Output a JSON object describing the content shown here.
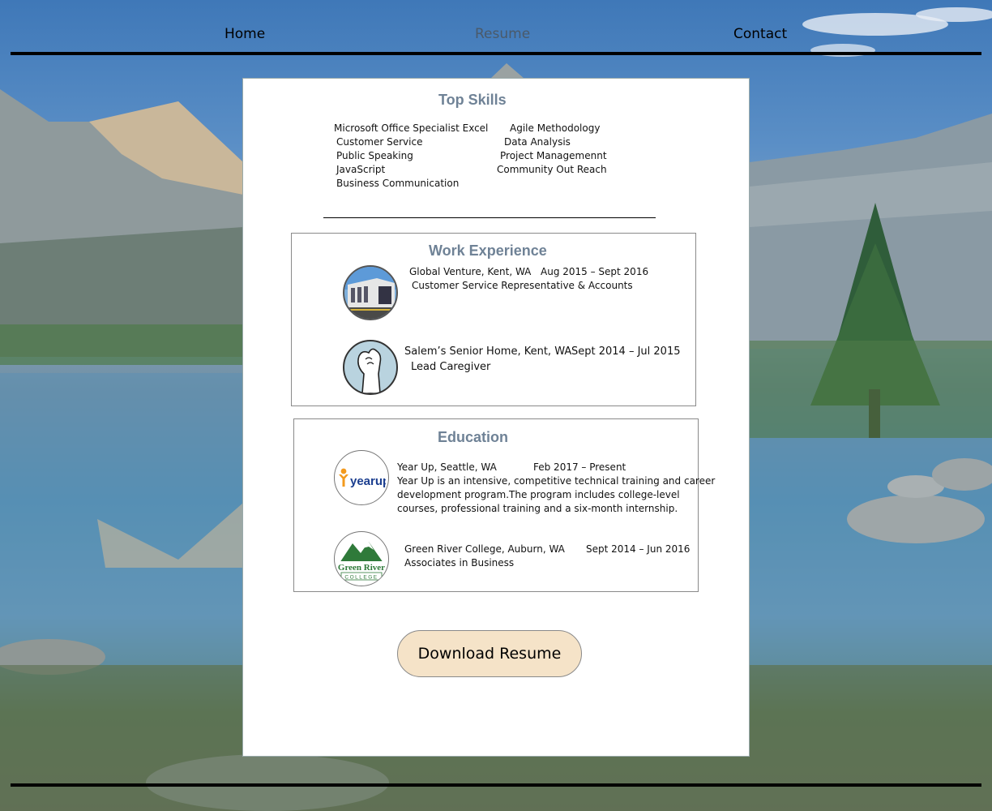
{
  "nav": {
    "home": "Home",
    "resume": "Resume",
    "contact": "Contact"
  },
  "skills": {
    "title": "Top Skills",
    "left": [
      "Microsoft Office Specialist Excel",
      "Customer Service",
      "Public Speaking",
      "JavaScript",
      "Business Communication"
    ],
    "right": [
      "Agile Methodology",
      "Data Analysis",
      "Project Managemennt",
      "Community Out Reach"
    ]
  },
  "work": {
    "title": "Work Experience",
    "jobs": [
      {
        "employer": "Global Venture, Kent, WA",
        "dates": "Aug 2015 – Sept 2016",
        "role": "Customer Service Representative & Accounts",
        "logo_icon": "office-building-icon"
      },
      {
        "employer": "Salem’s Senior Home, Kent, WA",
        "dates": "Sept 2014 – Jul 2015",
        "role": "Lead Caregiver",
        "logo_icon": "caring-hand-icon"
      }
    ]
  },
  "education": {
    "title": "Education",
    "schools": [
      {
        "name": "Year Up, Seattle, WA",
        "dates": "Feb 2017 – Present",
        "desc": [
          "Year Up is an intensive, competitive technical training and career",
          "development program.The program includes college-level",
          "courses, professional training and a six-month internship."
        ],
        "logo_text": "yearup"
      },
      {
        "name": "Green River College, Auburn, WA",
        "dates": "Sept 2014 – Jun 2016",
        "desc": [
          "Associates in Business"
        ],
        "logo_text": "Green River",
        "logo_subtext": "COLLEGE"
      }
    ]
  },
  "download_label": "Download Resume",
  "colors": {
    "heading": "#6f8296",
    "button_bg": "#f5e3c8",
    "yearup_orange": "#f39a1d",
    "yearup_blue": "#1b3e8f",
    "greenriver_green": "#2f7a3a"
  }
}
